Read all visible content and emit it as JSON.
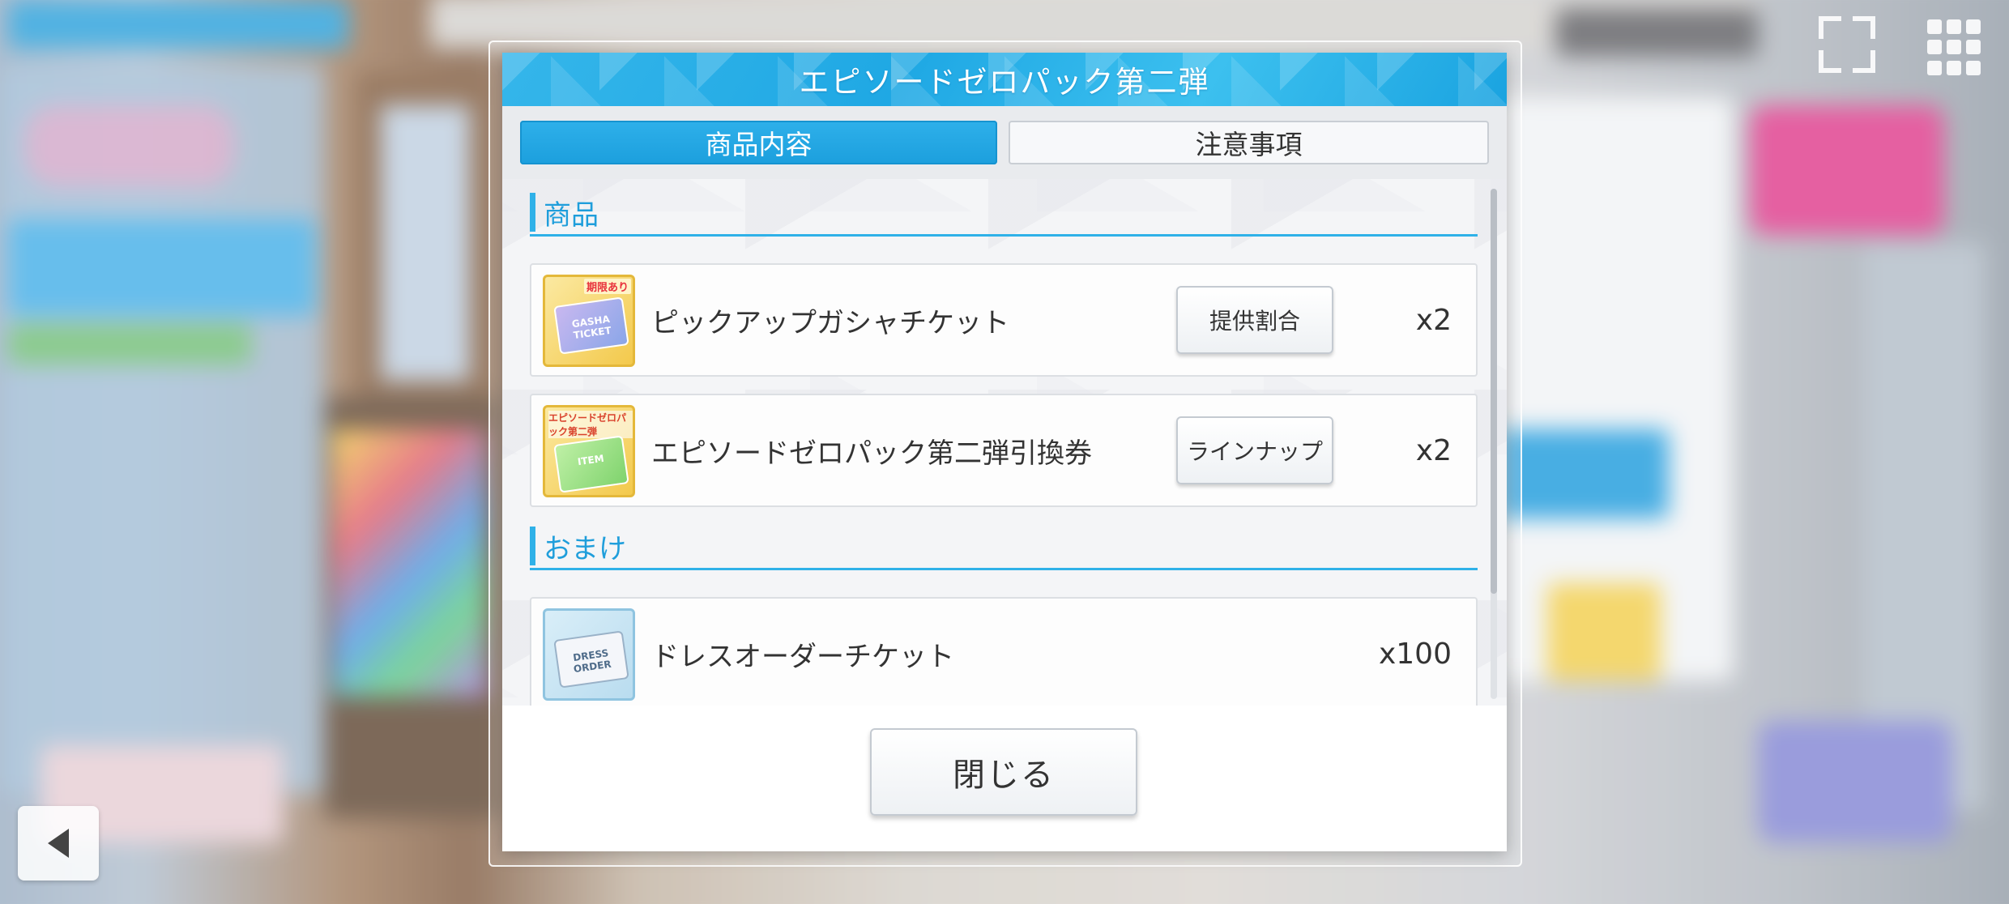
{
  "dialog": {
    "title": "エピソードゼロパック第二弾",
    "tabs": [
      {
        "label": "商品内容",
        "active": true
      },
      {
        "label": "注意事項",
        "active": false
      }
    ],
    "sections": [
      {
        "heading": "商品",
        "items": [
          {
            "name": "ピックアップガシャチケット",
            "button": "提供割合",
            "quantity": "x2",
            "icon": "gacha-ticket-icon",
            "icon_tag": "期限あり",
            "icon_text": "GASHA TICKET"
          },
          {
            "name": "エピソードゼロパック第二弾引換券",
            "button": "ラインナップ",
            "quantity": "x2",
            "icon": "item-ticket-icon",
            "icon_tag": "エピソードゼロパック第二弾",
            "icon_text": "ITEM"
          }
        ]
      },
      {
        "heading": "おまけ",
        "items": [
          {
            "name": "ドレスオーダーチケット",
            "quantity": "x100",
            "icon": "dress-order-ticket-icon",
            "icon_text": "DRESS ORDER"
          }
        ]
      }
    ],
    "close_label": "閉じる"
  },
  "colors": {
    "accent": "#2fb1e8",
    "header": "#1fa8e4",
    "limit_tag": "#e8313b"
  }
}
